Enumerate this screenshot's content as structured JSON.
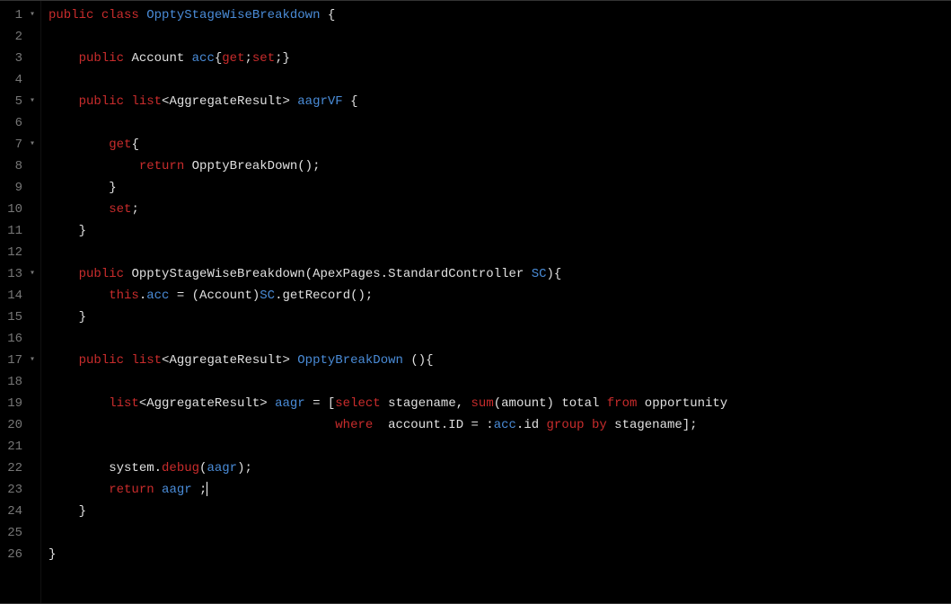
{
  "gutter": [
    {
      "n": "1",
      "fold": "▾"
    },
    {
      "n": "2",
      "fold": ""
    },
    {
      "n": "3",
      "fold": ""
    },
    {
      "n": "4",
      "fold": ""
    },
    {
      "n": "5",
      "fold": "▾"
    },
    {
      "n": "6",
      "fold": ""
    },
    {
      "n": "7",
      "fold": "▾"
    },
    {
      "n": "8",
      "fold": ""
    },
    {
      "n": "9",
      "fold": ""
    },
    {
      "n": "10",
      "fold": ""
    },
    {
      "n": "11",
      "fold": ""
    },
    {
      "n": "12",
      "fold": ""
    },
    {
      "n": "13",
      "fold": "▾"
    },
    {
      "n": "14",
      "fold": ""
    },
    {
      "n": "15",
      "fold": ""
    },
    {
      "n": "16",
      "fold": ""
    },
    {
      "n": "17",
      "fold": "▾"
    },
    {
      "n": "18",
      "fold": ""
    },
    {
      "n": "19",
      "fold": ""
    },
    {
      "n": "20",
      "fold": ""
    },
    {
      "n": "21",
      "fold": ""
    },
    {
      "n": "22",
      "fold": ""
    },
    {
      "n": "23",
      "fold": ""
    },
    {
      "n": "24",
      "fold": ""
    },
    {
      "n": "25",
      "fold": ""
    },
    {
      "n": "26",
      "fold": ""
    }
  ],
  "code": {
    "l1": {
      "a": "public",
      "b": "class",
      "c": "OpptyStageWiseBreakdown",
      "d": "{"
    },
    "l3": {
      "a": "public",
      "b": "Account",
      "c": "acc",
      "d": "{",
      "e": "get",
      "f": ";",
      "g": "set",
      "h": ";}"
    },
    "l5": {
      "a": "public",
      "b": "list",
      "c": "<AggregateResult>",
      "d": "aagrVF",
      "e": "{"
    },
    "l7": {
      "a": "get",
      "b": "{"
    },
    "l8": {
      "a": "return",
      "b": "OpptyBreakDown();"
    },
    "l9": {
      "a": "}"
    },
    "l10": {
      "a": "set",
      "b": ";"
    },
    "l11": {
      "a": "}"
    },
    "l13": {
      "a": "public",
      "b": "OpptyStageWiseBreakdown(ApexPages.StandardController",
      "c": "SC",
      "d": "){"
    },
    "l14": {
      "a": "this",
      "b": ".",
      "c": "acc",
      "d": " = (Account)",
      "e": "SC",
      "f": ".getRecord();"
    },
    "l15": {
      "a": "}"
    },
    "l17": {
      "a": "public",
      "b": "list",
      "c": "<AggregateResult>",
      "d": "OpptyBreakDown",
      "e": "(){"
    },
    "l19": {
      "a": "list",
      "b": "<AggregateResult>",
      "c": "aagr",
      "d": " = [",
      "e": "select",
      "f": " stagename, ",
      "g": "sum",
      "h": "(amount) total ",
      "i": "from",
      "j": " opportunity"
    },
    "l20": {
      "a": "where",
      "b": "  account.ID = :",
      "c": "acc",
      "d": ".id ",
      "e": "group",
      "f": " ",
      "g": "by",
      "h": " stagename];"
    },
    "l22": {
      "a": "system.",
      "b": "debug",
      "c": "(",
      "d": "aagr",
      "e": ");"
    },
    "l23": {
      "a": "return",
      "b": "aagr",
      "c": " ;"
    },
    "l24": {
      "a": "}"
    },
    "l26": {
      "a": "}"
    }
  }
}
